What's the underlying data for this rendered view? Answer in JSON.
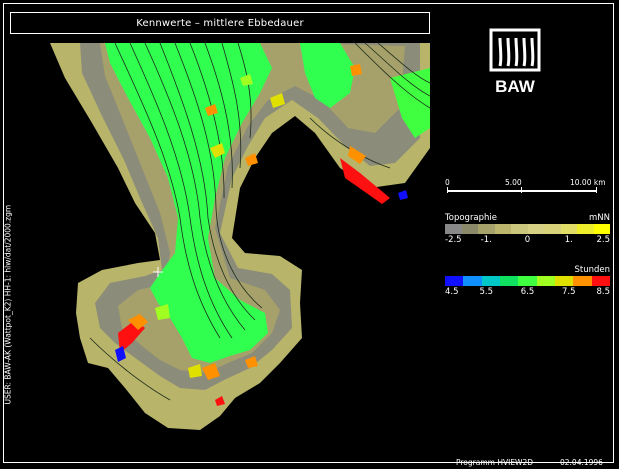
{
  "title": "Kennwerte – mittlere Ebbedauer",
  "logo": {
    "text": "BAW"
  },
  "scale": {
    "labels": [
      "0",
      "5.00",
      "10.00 km"
    ]
  },
  "topography_legend": {
    "title": "Topographie",
    "unit": "mNN",
    "colors": [
      "#888888",
      "#8a8a6a",
      "#a6a06a",
      "#bcb56d",
      "#cbc67e",
      "#d5d084",
      "#d8d37a",
      "#e0dc66",
      "#eded2c",
      "#ffff00"
    ],
    "ticks": [
      "-2.5",
      "-1.",
      "0",
      "1.",
      "2.5"
    ]
  },
  "hours_legend": {
    "title": "Stunden",
    "colors": [
      "#1010ff",
      "#1090ff",
      "#00c8c8",
      "#10e060",
      "#40ff40",
      "#a0ff20",
      "#e0e000",
      "#ff9000",
      "#ff1010"
    ],
    "ticks": [
      "4.5",
      "5.5",
      "6.5",
      "7.5",
      "8.5"
    ]
  },
  "side_text": "USER: BAW-AK (Wattpot_K2)   HH-1: hlw/dat/2000.zgm",
  "footer": {
    "program": "Programm HVIEW2D",
    "date": "02.04.1996"
  },
  "colors": {
    "land": "#b8b46a",
    "tidal_flat": "#8c8c7a",
    "channel": "#30ff50",
    "background": "#000000"
  }
}
